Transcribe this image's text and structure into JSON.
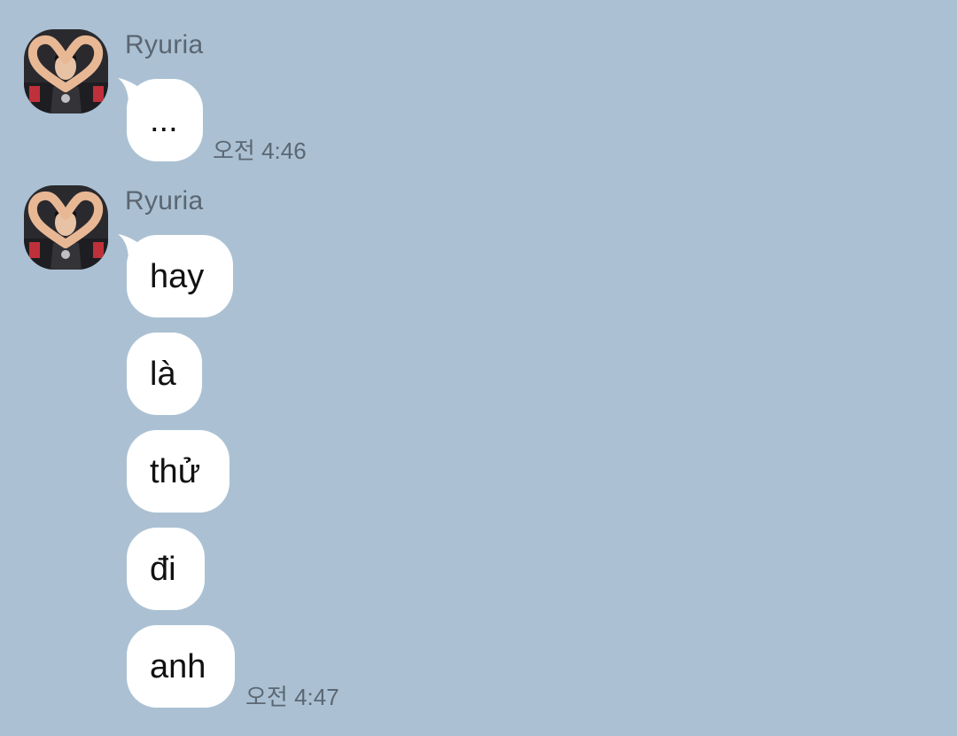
{
  "chat": {
    "background_color": "#abc1d3",
    "bubble_color": "#ffffff",
    "groups": [
      {
        "sender": "Ryuria",
        "messages": [
          "..."
        ],
        "timestamp": "오전 4:46"
      },
      {
        "sender": "Ryuria",
        "messages": [
          "hay",
          "là",
          "thử",
          "đi",
          "anh"
        ],
        "timestamp": "오전 4:47"
      }
    ]
  }
}
